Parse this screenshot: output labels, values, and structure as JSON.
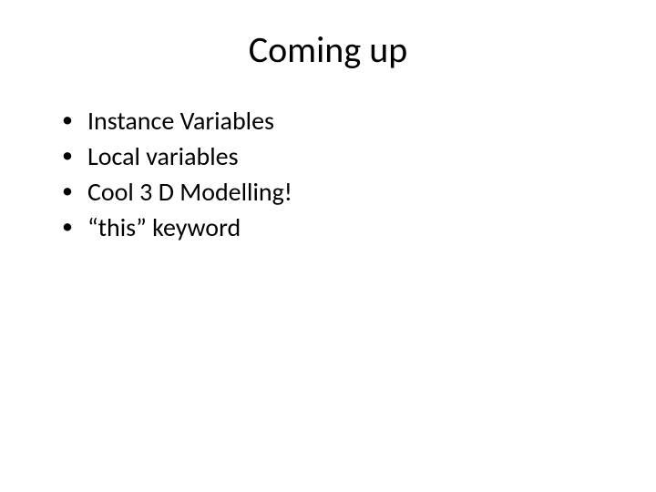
{
  "slide": {
    "title": "Coming up",
    "bullets": [
      "Instance Variables",
      "Local variables",
      "Cool 3 D Modelling!",
      "“this” keyword"
    ]
  }
}
